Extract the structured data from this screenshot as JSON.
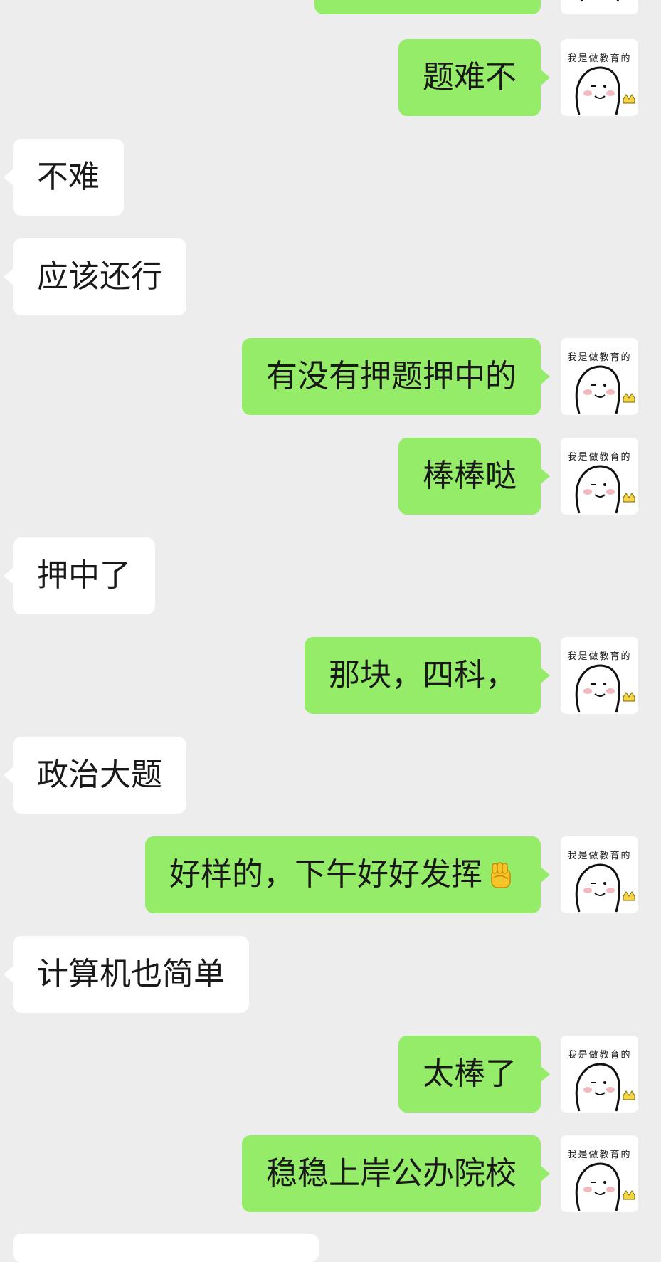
{
  "messages": [
    {
      "text": "",
      "side": "mine"
    },
    {
      "text": "题难不",
      "side": "mine"
    },
    {
      "text": "不难",
      "side": "theirs"
    },
    {
      "text": "应该还行",
      "side": "theirs"
    },
    {
      "text": "有没有押题押中的",
      "side": "mine"
    },
    {
      "text": "棒棒哒",
      "side": "mine"
    },
    {
      "text": "押中了",
      "side": "theirs"
    },
    {
      "text": "那块，四科，",
      "side": "mine"
    },
    {
      "text": "政治大题",
      "side": "theirs"
    },
    {
      "text": "好样的，下午好好发挥",
      "side": "mine",
      "emoji": "fist-emoji"
    },
    {
      "text": "计算机也简单",
      "side": "theirs"
    },
    {
      "text": "太棒了",
      "side": "mine"
    },
    {
      "text": "稳稳上岸公办院校",
      "side": "mine"
    }
  ],
  "avatar": {
    "caption": "我是做教育的",
    "icon": "smiling-face-with-crown-avatar"
  },
  "colors": {
    "background": "#ededed",
    "mine_bubble": "#95ec69",
    "theirs_bubble": "#ffffff",
    "text": "#191919"
  }
}
